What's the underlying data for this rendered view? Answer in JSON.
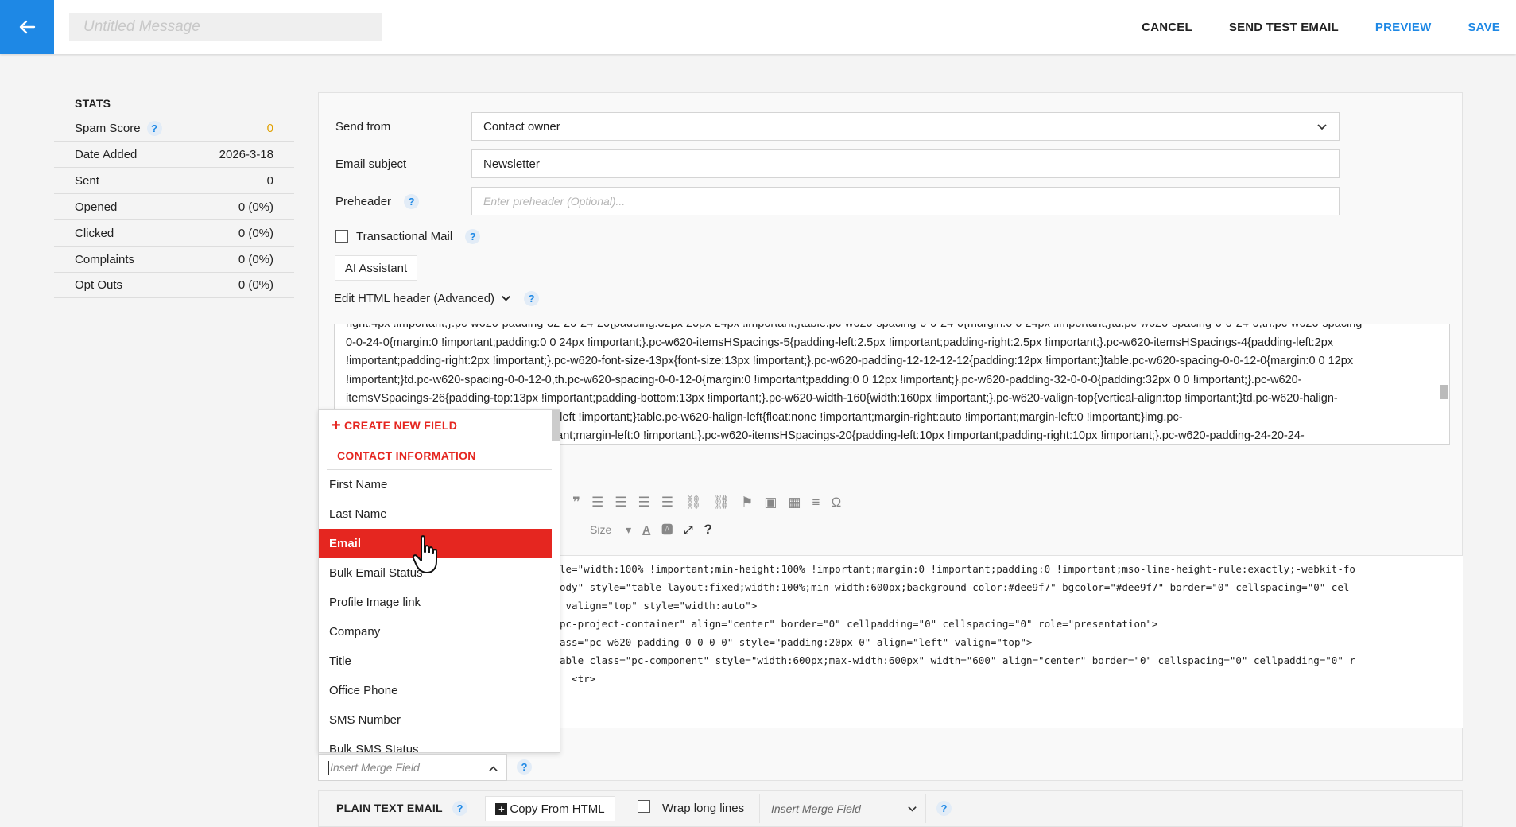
{
  "topbar": {
    "title_placeholder": "Untitled Message",
    "cancel": "CANCEL",
    "send_test": "SEND TEST EMAIL",
    "preview": "PREVIEW",
    "save": "SAVE",
    "back_icon": "arrow-left-icon",
    "accent_color": "#1e88e5"
  },
  "stats": {
    "title": "STATS",
    "rows": [
      {
        "label": "Spam Score",
        "value": "0"
      },
      {
        "label": "Date Added",
        "value": "2026-3-18"
      },
      {
        "label": "Sent",
        "value": "0"
      },
      {
        "label": "Opened",
        "value": "0 (0%)"
      },
      {
        "label": "Clicked",
        "value": "0 (0%)"
      },
      {
        "label": "Complaints",
        "value": "0 (0%)"
      },
      {
        "label": "Opt Outs",
        "value": "0 (0%)"
      }
    ]
  },
  "form": {
    "send_from_label": "Send from",
    "send_from_value": "Contact owner",
    "subject_label": "Email subject",
    "subject_value": "Newsletter",
    "preheader_label": "Preheader",
    "preheader_placeholder": "Enter preheader (Optional)...",
    "transactional_label": "Transactional Mail",
    "ai_assistant": "AI Assistant",
    "edit_header": "Edit HTML header (Advanced)",
    "help": "?"
  },
  "header_code": [
    "right:4px !important;}.pc-w620-padding-32-20-24-20{padding:32px 20px 24px !important;}table.pc-w620-spacing-0-0-24-0{margin:0 0 24px !important;}td.pc-w620-spacing-0-0-24-0,th.pc-w620-spacing-",
    "0-0-24-0{margin:0 !important;padding:0 0 24px !important;}.pc-w620-itemsHSpacings-5{padding-left:2.5px !important;padding-right:2.5px !important;}.pc-w620-itemsHSpacings-4{padding-left:2px",
    "!important;padding-right:2px !important;}.pc-w620-font-size-13px{font-size:13px !important;}.pc-w620-padding-12-12-12-12{padding:12px !important;}table.pc-w620-spacing-0-0-12-0{margin:0 0 12px",
    "!important;}td.pc-w620-spacing-0-0-12-0,th.pc-w620-spacing-0-0-12-0{margin:0 !important;padding:0 0 12px !important;}.pc-w620-padding-32-0-0-0{padding:32px 0 0 !important;}.pc-w620-",
    "itemsVSpacings-26{padding-top:13px !important;padding-bottom:13px !important;}.pc-w620-width-160{width:160px !important;}.pc-w620-valign-top{vertical-align:top !important;}td.pc-w620-halign-",
    "left{text-align:left !important;text-align-last:left !important;}table.pc-w620-halign-left{float:none !important;margin-right:auto !important;margin-left:0 !important;}img.pc-",
    "w620-halign-left{margin-right:auto !important;margin-left:0 !important;}.pc-w620-itemsHSpacings-20{padding-left:10px !important;padding-right:10px !important;}.pc-w620-padding-24-20-24-"
  ],
  "editor": {
    "size_label": "Size",
    "source_lines": [
      "le=\"width:100% !important;min-height:100% !important;margin:0 !important;padding:0 !important;mso-line-height-rule:exactly;-webkit-fo",
      "ody\" style=\"table-layout:fixed;width:100%;min-width:600px;background-color:#dee9f7\" bgcolor=\"#dee9f7\" border=\"0\" cellspacing=\"0\" cel",
      "",
      " valign=\"top\" style=\"width:auto\">",
      "pc-project-container\" align=\"center\" border=\"0\" cellpadding=\"0\" cellspacing=\"0\" role=\"presentation\">",
      "",
      "ass=\"pc-w620-padding-0-0-0-0\" style=\"padding:20px 0\" align=\"left\" valign=\"top\">",
      "able class=\"pc-component\" style=\"width:600px;max-width:600px\" width=\"600\" align=\"center\" border=\"0\" cellspacing=\"0\" cellpadding=\"0\" r",
      "  <tr>"
    ]
  },
  "merge_dropdown": {
    "create": "CREATE NEW FIELD",
    "section": "CONTACT INFORMATION",
    "items": [
      "First Name",
      "Last Name",
      "Email",
      "Bulk Email Status",
      "Profile Image link",
      "Company",
      "Title",
      "Office Phone",
      "SMS Number",
      "Bulk SMS Status"
    ],
    "active_index": 2,
    "active_color": "#e52620",
    "input_placeholder": "Insert Merge Field"
  },
  "bottom": {
    "plain_text": "PLAIN TEXT EMAIL",
    "copy_html": "Copy From HTML",
    "wrap": "Wrap long lines",
    "merge_placeholder": "Insert Merge Field"
  }
}
